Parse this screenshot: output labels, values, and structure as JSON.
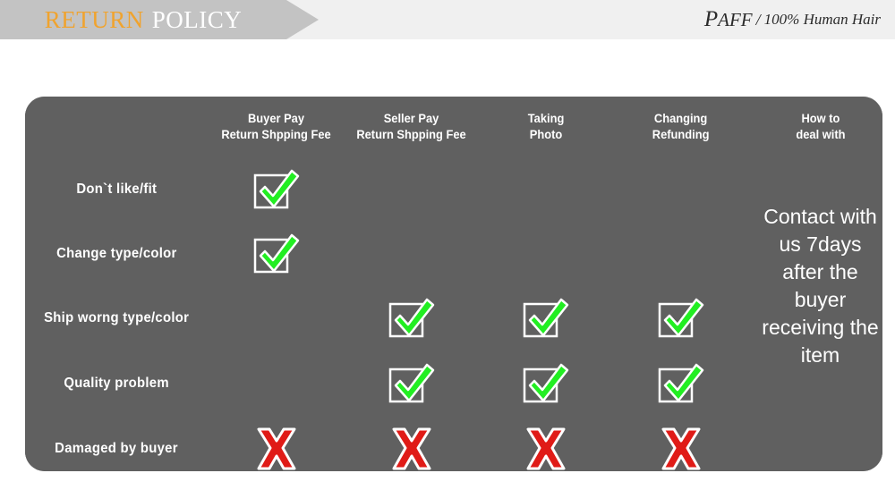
{
  "banner": {
    "title_primary": "RETURN",
    "title_secondary": "POLICY",
    "primary_color": "#f0a32e",
    "secondary_color": "#ffffff",
    "strip_color": "#c3c3c3"
  },
  "brand": {
    "initial": "P",
    "name_rest": "AFF",
    "separator": "/",
    "tagline": "100% Human Hair"
  },
  "table": {
    "background_color": "#606060",
    "grid_color": "#ffffff",
    "check_color": "#22ee22",
    "cross_color": "#e01b17",
    "corner_header": "",
    "columns": [
      {
        "label": "",
        "key": "rowhead"
      },
      {
        "line1": "Buyer Pay",
        "line2": "Return Shpping Fee",
        "key": "buyer_pay"
      },
      {
        "line1": "Seller Pay",
        "line2": "Return Shpping Fee",
        "key": "seller_pay"
      },
      {
        "line1": "Taking",
        "line2": "Photo",
        "key": "taking_photo"
      },
      {
        "line1": "Changing",
        "line2": "Refunding",
        "key": "changing_refunding"
      },
      {
        "line1": "How to",
        "line2": "deal with",
        "key": "how_to_deal_with"
      }
    ],
    "rows": [
      {
        "label": "Don`t  like/fit",
        "buyer_pay": "check",
        "seller_pay": "",
        "taking_photo": "",
        "changing_refunding": ""
      },
      {
        "label": "Change  type/color",
        "buyer_pay": "check",
        "seller_pay": "",
        "taking_photo": "",
        "changing_refunding": ""
      },
      {
        "label": "Ship  worng  type/color",
        "buyer_pay": "",
        "seller_pay": "check",
        "taking_photo": "check",
        "changing_refunding": "check"
      },
      {
        "label": "Quality  problem",
        "buyer_pay": "",
        "seller_pay": "check",
        "taking_photo": "check",
        "changing_refunding": "check"
      },
      {
        "label": "Damaged  by  buyer",
        "buyer_pay": "cross",
        "seller_pay": "cross",
        "taking_photo": "cross",
        "changing_refunding": "cross"
      }
    ],
    "how_to_deal_with_note": "Contact with us 7days after the buyer receiving the item"
  },
  "icons": {
    "check": "checkbox-check-icon",
    "cross": "cross-x-icon"
  }
}
